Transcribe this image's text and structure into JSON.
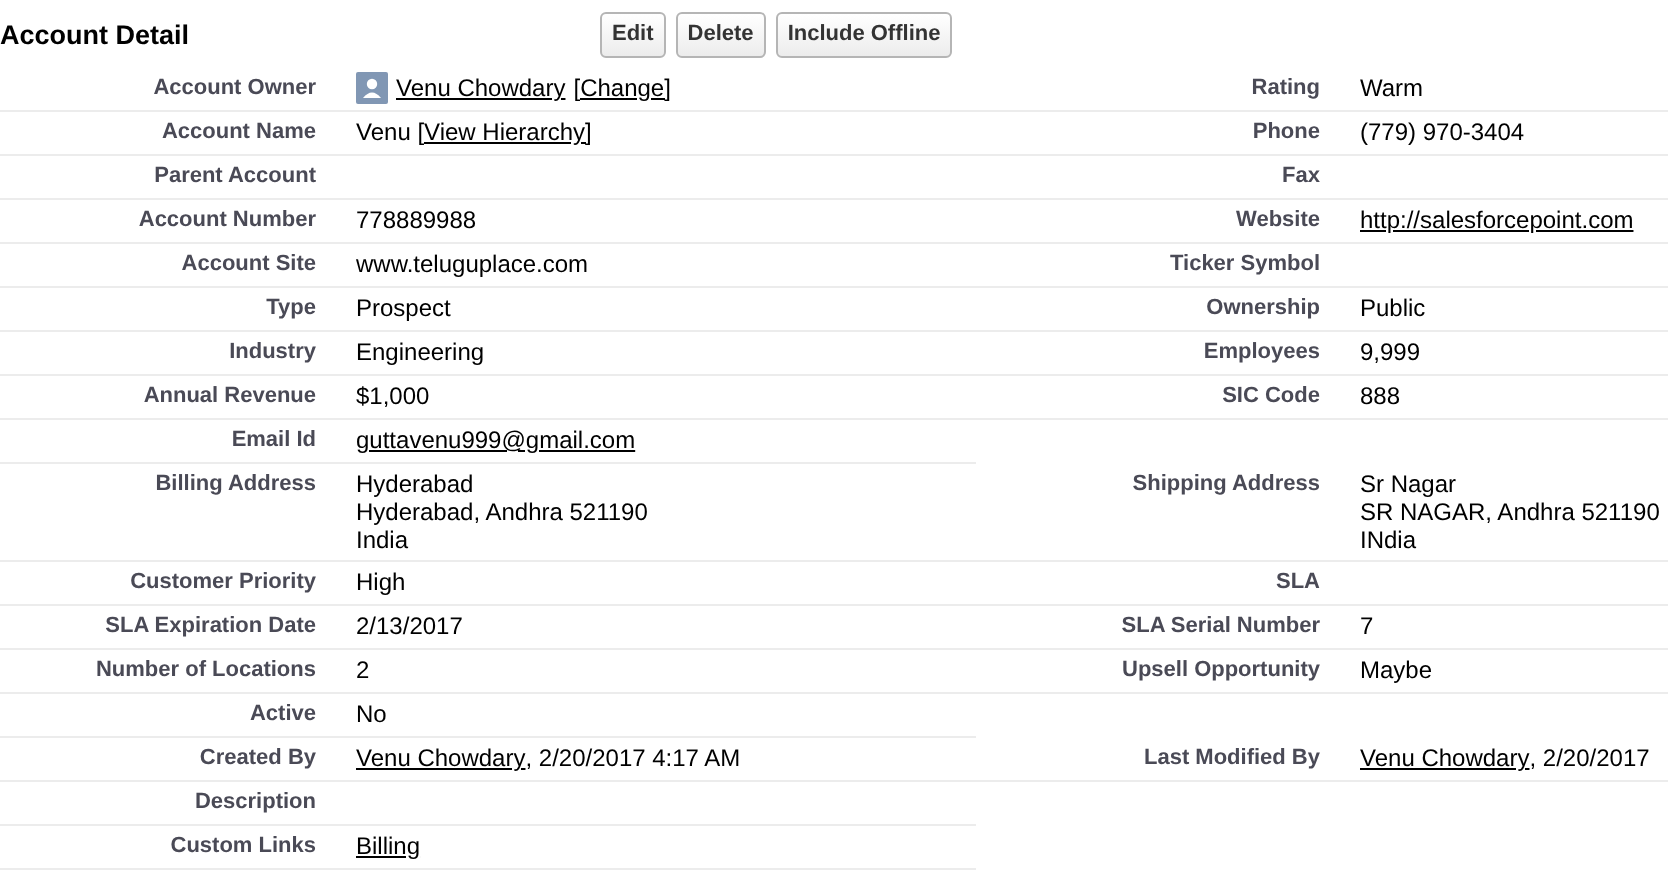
{
  "section": {
    "title": "Account Detail"
  },
  "buttons": [
    {
      "label": "Edit"
    },
    {
      "label": "Delete"
    },
    {
      "label": "Include Offline"
    }
  ],
  "rows": [
    {
      "left": {
        "label": "Account Owner",
        "avatar": true,
        "value": [
          {
            "text": "Venu Chowdary",
            "link": true
          },
          {
            "text": "[Change]",
            "link": true
          }
        ]
      },
      "right": {
        "label": "Rating",
        "value": [
          {
            "text": "Warm",
            "link": false
          }
        ]
      }
    },
    {
      "left": {
        "label": "Account Name",
        "value": [
          {
            "text": "Venu ",
            "link": false
          },
          {
            "text": "[View Hierarchy]",
            "link": true
          }
        ]
      },
      "right": {
        "label": "Phone",
        "value": [
          {
            "text": "(779) 970-3404",
            "link": false
          }
        ]
      }
    },
    {
      "left": {
        "label": "Parent Account"
      },
      "right": {
        "label": "Fax"
      }
    },
    {
      "left": {
        "label": "Account Number",
        "value": [
          {
            "text": "778889988",
            "link": false
          }
        ]
      },
      "right": {
        "label": "Website",
        "value": [
          {
            "text": "http://salesforcepoint.com",
            "link": true
          }
        ]
      }
    },
    {
      "left": {
        "label": "Account Site",
        "value": [
          {
            "text": "www.teluguplace.com",
            "link": false
          }
        ]
      },
      "right": {
        "label": "Ticker Symbol"
      }
    },
    {
      "left": {
        "label": "Type",
        "value": [
          {
            "text": "Prospect",
            "link": false
          }
        ]
      },
      "right": {
        "label": "Ownership",
        "value": [
          {
            "text": "Public",
            "link": false
          }
        ]
      }
    },
    {
      "left": {
        "label": "Industry",
        "value": [
          {
            "text": "Engineering",
            "link": false
          }
        ]
      },
      "right": {
        "label": "Employees",
        "value": [
          {
            "text": "9,999",
            "link": false
          }
        ]
      }
    },
    {
      "left": {
        "label": "Annual Revenue",
        "value": [
          {
            "text": "$1,000",
            "link": false
          }
        ]
      },
      "right": {
        "label": "SIC Code",
        "value": [
          {
            "text": "888",
            "link": false
          }
        ]
      }
    },
    {
      "left": {
        "label": "Email Id",
        "value": [
          {
            "text": "guttavenu999@gmail.com",
            "link": true
          }
        ]
      }
    },
    {
      "left": {
        "label": "Billing Address",
        "value": [
          {
            "text": "Hyderabad\nHyderabad, Andhra 521190\nIndia",
            "link": false
          }
        ]
      },
      "right": {
        "label": "Shipping Address",
        "value": [
          {
            "text": "Sr Nagar\nSR NAGAR, Andhra 521190\nINdia",
            "link": false
          }
        ]
      }
    },
    {
      "left": {
        "label": "Customer Priority",
        "value": [
          {
            "text": "High",
            "link": false
          }
        ]
      },
      "right": {
        "label": "SLA"
      }
    },
    {
      "left": {
        "label": "SLA Expiration Date",
        "value": [
          {
            "text": "2/13/2017",
            "link": false
          }
        ]
      },
      "right": {
        "label": "SLA Serial Number",
        "value": [
          {
            "text": "7",
            "link": false
          }
        ]
      }
    },
    {
      "left": {
        "label": "Number of Locations",
        "value": [
          {
            "text": "2",
            "link": false
          }
        ]
      },
      "right": {
        "label": "Upsell Opportunity",
        "value": [
          {
            "text": "Maybe",
            "link": false
          }
        ]
      }
    },
    {
      "left": {
        "label": "Active",
        "value": [
          {
            "text": "No",
            "link": false
          }
        ]
      }
    },
    {
      "left": {
        "label": "Created By",
        "value": [
          {
            "text": "Venu Chowdary",
            "link": true
          },
          {
            "text": ", 2/20/2017 4:17 AM",
            "link": false
          }
        ]
      },
      "right": {
        "label": "Last Modified By",
        "value": [
          {
            "text": "Venu Chowdary",
            "link": true
          },
          {
            "text": ", 2/20/2017",
            "link": false
          }
        ]
      }
    },
    {
      "left": {
        "label": "Description"
      }
    },
    {
      "left": {
        "label": "Custom Links",
        "value": [
          {
            "text": "Billing",
            "link": true
          }
        ]
      }
    }
  ]
}
